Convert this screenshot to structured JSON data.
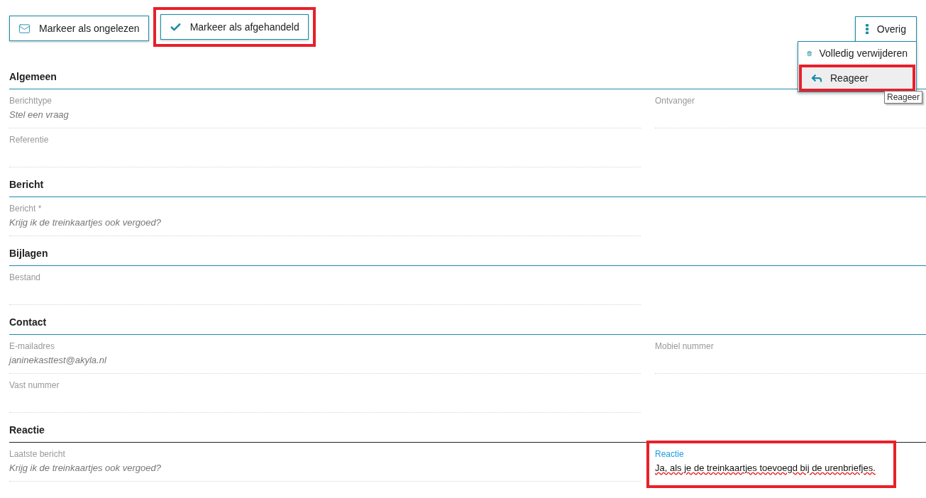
{
  "toolbar": {
    "buttons": [
      {
        "kind": "mail",
        "label": "Markeer als ongelezen",
        "highlighted": false
      },
      {
        "kind": "check",
        "label": "Markeer als afgehandeld",
        "highlighted": true
      }
    ]
  },
  "more_menu": {
    "label": "Overig",
    "expanded": true,
    "items": [
      {
        "kind": "trash",
        "label": "Volledig verwijderen",
        "selected": false,
        "highlighted": false
      },
      {
        "kind": "reply",
        "label": "Reageer",
        "selected": true,
        "highlighted": true
      }
    ],
    "tooltip": "Reageer"
  },
  "sections": [
    {
      "title": "Algemeen",
      "color": "#1a8ca8",
      "rows": [
        [
          {
            "label": "Berichttype",
            "value": "Stel een vraag",
            "focused": false,
            "highlighted": false
          },
          {
            "label": "Ontvanger",
            "focused": false,
            "highlighted": false
          }
        ],
        [
          {
            "label": "Referentie",
            "focused": false,
            "highlighted": false
          }
        ]
      ]
    },
    {
      "title": "Bericht",
      "color": "#1a8ca8",
      "rows": [
        [
          {
            "label": "Bericht *",
            "value": "Krijg ik de treinkaartjes ook vergoed?",
            "focused": false,
            "highlighted": false
          }
        ]
      ]
    },
    {
      "title": "Bijlagen",
      "color": "#1a8ca8",
      "rows": [
        [
          {
            "label": "Bestand",
            "focused": false,
            "highlighted": false
          }
        ]
      ]
    },
    {
      "title": "Contact",
      "color": "#1a8ca8",
      "rows": [
        [
          {
            "label": "E-mailadres",
            "value": "janinekasttest@akyla.nl",
            "focused": false,
            "highlighted": false
          },
          {
            "label": "Mobiel nummer",
            "focused": false,
            "highlighted": false
          }
        ],
        [
          {
            "label": "Vast nummer",
            "focused": false,
            "highlighted": false
          }
        ]
      ]
    },
    {
      "title": "Reactie",
      "color": "#222222",
      "rows": [
        [
          {
            "label": "Laatste bericht",
            "value": "Krijg ik de treinkaartjes ook vergoed?",
            "focused": false,
            "highlighted": false
          },
          {
            "label": "Reactie",
            "value": "Ja, als je de treinkaartjes toevoegd bij de urenbriefjes.",
            "focused": true,
            "highlighted": true
          }
        ]
      ]
    }
  ]
}
